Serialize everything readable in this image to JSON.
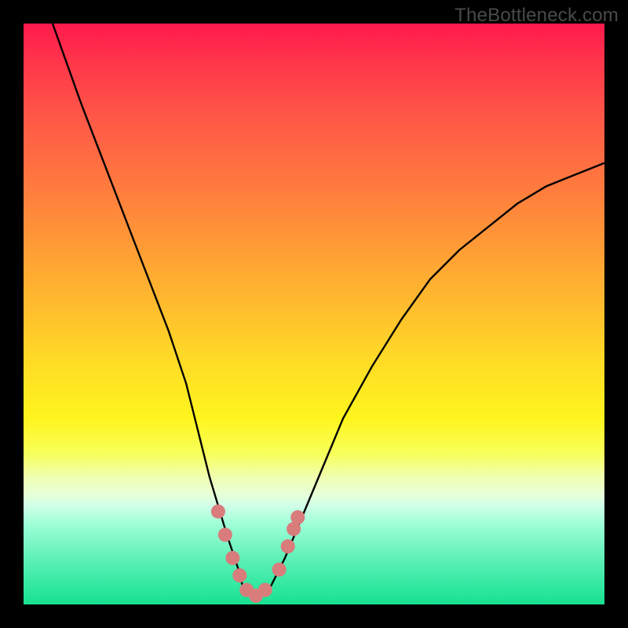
{
  "watermark": "TheBottleneck.com",
  "chart_data": {
    "type": "line",
    "title": "",
    "xlabel": "",
    "ylabel": "",
    "xlim": [
      0,
      100
    ],
    "ylim": [
      0,
      100
    ],
    "series": [
      {
        "name": "bottleneck-curve",
        "x": [
          5,
          10,
          15,
          20,
          25,
          28,
          30,
          32,
          35,
          37,
          38,
          42,
          43,
          45,
          50,
          55,
          60,
          65,
          70,
          75,
          80,
          85,
          90,
          95,
          100
        ],
        "values": [
          100,
          86,
          73,
          60,
          47,
          38,
          30,
          22,
          12,
          6,
          2,
          2,
          4,
          8,
          20,
          32,
          41,
          49,
          56,
          61,
          65,
          69,
          72,
          74,
          76
        ]
      }
    ],
    "markers": {
      "name": "highlight-beads",
      "color": "#d97c7c",
      "points": [
        {
          "x": 33.5,
          "y": 16
        },
        {
          "x": 34.7,
          "y": 12
        },
        {
          "x": 36.0,
          "y": 8
        },
        {
          "x": 37.2,
          "y": 5
        },
        {
          "x": 38.4,
          "y": 2.5
        },
        {
          "x": 40.0,
          "y": 1.5
        },
        {
          "x": 41.6,
          "y": 2.5
        },
        {
          "x": 44.0,
          "y": 6
        },
        {
          "x": 45.5,
          "y": 10
        },
        {
          "x": 46.5,
          "y": 13
        },
        {
          "x": 47.2,
          "y": 15
        }
      ]
    },
    "background_gradient": {
      "top": "#ff1a4d",
      "mid": "#ffdb26",
      "bottom": "#18e090"
    }
  }
}
